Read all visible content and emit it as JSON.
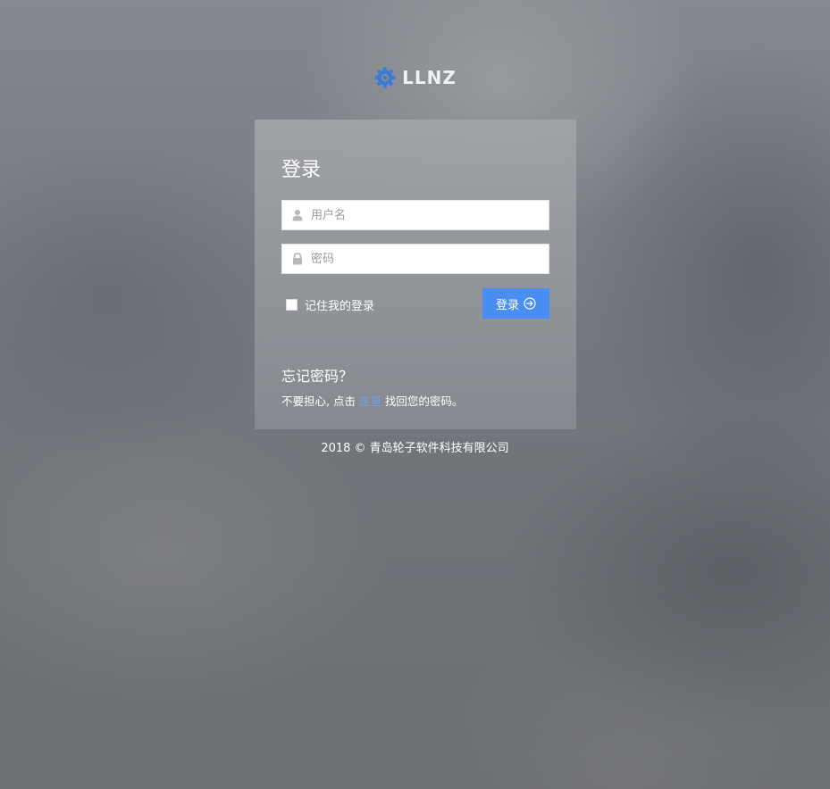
{
  "logo": {
    "text": "LLNZ",
    "icon": "gear-icon",
    "icon_color": "#3a7bd5"
  },
  "login": {
    "title": "登录",
    "username_placeholder": "用户名",
    "username_value": "",
    "username_icon": "user-icon",
    "password_placeholder": "密码",
    "password_value": "",
    "password_icon": "lock-icon",
    "remember_label": "记住我的登录",
    "remember_checked": false,
    "submit_label": "登录",
    "submit_icon": "arrow-right-circle-icon",
    "accent_color": "#4a8df3"
  },
  "forgot": {
    "title": "忘记密码？",
    "text_before": "不要担心, 点击 ",
    "link_text": "这里",
    "text_after": " 找回您的密码。"
  },
  "footer": {
    "text": "2018 © 青岛轮子软件科技有限公司"
  }
}
